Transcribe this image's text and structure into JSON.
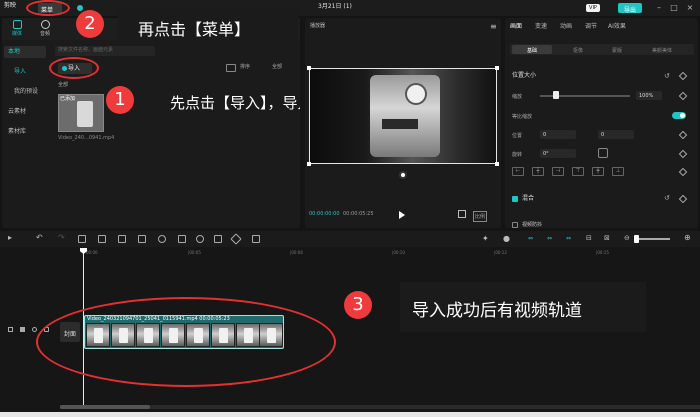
{
  "app": {
    "logo_label": "剪映",
    "menu_label": "菜单",
    "project_date": "3月21日 (1)",
    "vip_label": "VIP",
    "share_label": "导出"
  },
  "media_panel": {
    "tabs": [
      {
        "label": "媒体",
        "icon": "media-icon"
      },
      {
        "label": "音频",
        "icon": "audio-icon"
      }
    ],
    "nav": {
      "local": "本地",
      "import": "导入",
      "preset": "我的预设",
      "cloud": "云素材",
      "library": "素材库"
    },
    "search_placeholder": "搜索文件名称、画面元素",
    "import_button": "导入",
    "sort_label": "排序",
    "all_filter": "全部",
    "all_label": "全部",
    "clip": {
      "added_badge": "已添加",
      "name": "Video_240...0941.mp4"
    }
  },
  "player": {
    "title": "播放器",
    "current_time": "00:00:00:00",
    "total_time": "00:00:05:25",
    "ratio_label": "比例"
  },
  "props": {
    "tabs": [
      "画面",
      "变速",
      "动画",
      "调节",
      "AI效果"
    ],
    "subtabs": [
      "基础",
      "抠像",
      "蒙版",
      "美颜美体"
    ],
    "section_position": "位置大小",
    "scale_label": "缩放",
    "scale_value": "100%",
    "uniform_label": "等比缩放",
    "position_label": "位置",
    "pos_x": "0",
    "pos_y": "0",
    "rotate_label": "旋转",
    "rotate_value": "0°",
    "blend_label": "混合",
    "stabilize_label": "视频防抖"
  },
  "timeline": {
    "ticks": [
      "00:00",
      "|00:05",
      "|00:06",
      "|00:10",
      "|00:12",
      "|00:15"
    ],
    "cover_label": "封面",
    "clip_label": "Video_240321094701_25041_0115941.mp4  00:00:05:23"
  },
  "annotations": [
    {
      "number": "2",
      "text": "再点击【菜单】"
    },
    {
      "number": "1",
      "text": "先点击【导入】，导入视频"
    },
    {
      "number": "3",
      "text": "导入成功后有视频轨道"
    }
  ],
  "colors": {
    "accent": "#20c5c5",
    "highlight": "#e53030",
    "background": "#141414"
  }
}
